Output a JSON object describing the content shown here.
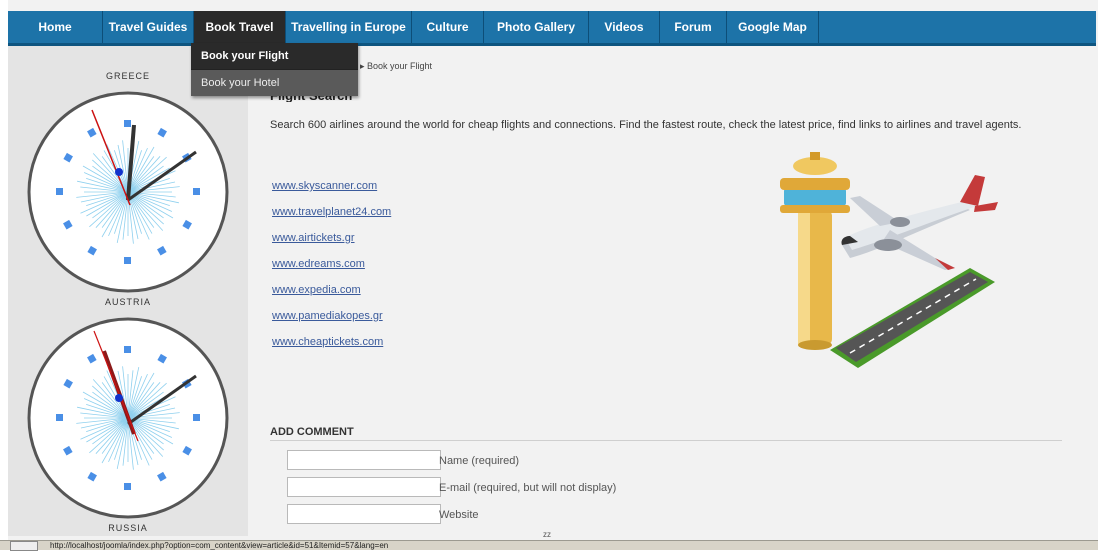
{
  "nav": {
    "items": [
      "Home",
      "Travel Guides",
      "Book Travel",
      "Travelling in Europe",
      "Culture",
      "Photo Gallery",
      "Videos",
      "Forum",
      "Google Map"
    ],
    "active_index": 2
  },
  "dropdown": {
    "items": [
      "Book your Flight",
      "Book your Hotel"
    ]
  },
  "sidebar": {
    "clock_labels": [
      "GREECE",
      "AUSTRIA",
      "RUSSIA"
    ]
  },
  "main": {
    "breadcrumb": "Book your Flight",
    "heading": "Flight Search",
    "intro": "Search 600 airlines around the world for cheap flights and connections. Find the fastest route, check the latest price, find links to airlines and travel agents.",
    "links": [
      "www.skyscanner.com",
      "www.travelplanet24.com",
      "www.airtickets.gr",
      "www.edreams.com",
      "www.expedia.com",
      "www.pamediakopes.gr",
      "www.cheaptickets.com"
    ]
  },
  "comment": {
    "title": "ADD COMMENT",
    "fields": [
      "Name (required)",
      "E-mail (required, but will not display)",
      "Website"
    ]
  },
  "misc": {
    "zz": "zz"
  },
  "status": {
    "url": "http://localhost/joomla/index.php?option=com_content&view=article&id=51&Itemid=57&lang=en"
  },
  "colors": {
    "nav_bg": "#1d73a8",
    "link": "#3a5a9b",
    "hour_hand": "#c01010"
  }
}
